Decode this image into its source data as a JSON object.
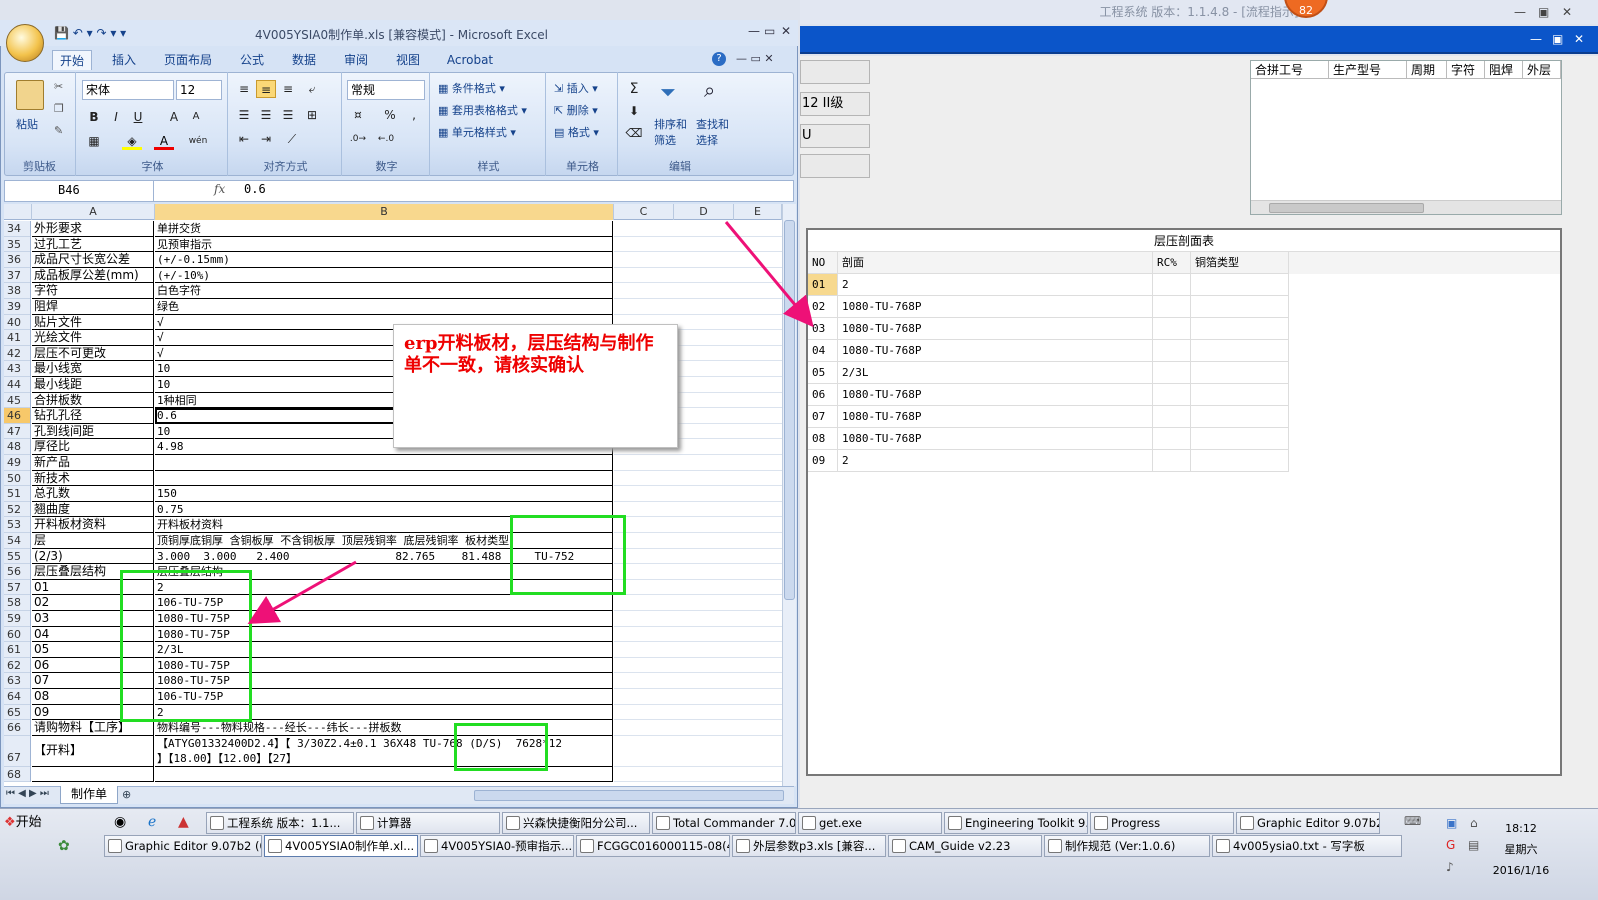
{
  "right_app": {
    "title": "工程系统  版本：1.1.4.8 - [流程指示]",
    "badge": "82",
    "left_buttons": [
      "",
      "12 II级",
      "U",
      ""
    ],
    "info_columns": [
      "合拼工号",
      "生产型号",
      "周期",
      "字符",
      "阻焊",
      "外层"
    ],
    "stack_title": "层压剖面表",
    "stack_columns": [
      "NO",
      "剖面",
      "RC%",
      "铜箔类型"
    ],
    "stack_rows": [
      [
        "01",
        "2"
      ],
      [
        "02",
        "1080-TU-768P"
      ],
      [
        "03",
        "1080-TU-768P"
      ],
      [
        "04",
        "1080-TU-768P"
      ],
      [
        "05",
        "2/3L"
      ],
      [
        "06",
        "1080-TU-768P"
      ],
      [
        "07",
        "1080-TU-768P"
      ],
      [
        "08",
        "1080-TU-768P"
      ],
      [
        "09",
        "2"
      ]
    ]
  },
  "excel": {
    "title": "4V005YSIA0制作单.xls  [兼容模式] - Microsoft Excel",
    "tabs": [
      "开始",
      "插入",
      "页面布局",
      "公式",
      "数据",
      "审阅",
      "视图",
      "Acrobat"
    ],
    "groups": [
      "剪贴板",
      "字体",
      "对齐方式",
      "数字",
      "样式",
      "单元格",
      "编辑"
    ],
    "paste": "粘贴",
    "font_name": "宋体",
    "font_size": "12",
    "number_format": "常规",
    "style_items": [
      "条件格式",
      "套用表格格式",
      "单元格样式"
    ],
    "cell_items": [
      "插入",
      "删除",
      "格式"
    ],
    "edit_items": [
      "排序和筛选",
      "查找和选择"
    ],
    "name_box": "B46",
    "formula_value": "0.6",
    "columns": [
      "A",
      "B",
      "C",
      "D",
      "E"
    ],
    "rows": [
      {
        "n": "34",
        "a": "外形要求",
        "b": "单拼交货"
      },
      {
        "n": "35",
        "a": "过孔工艺",
        "b": "见预审指示"
      },
      {
        "n": "36",
        "a": "成品尺寸长宽公差",
        "b": "(+/-0.15mm)"
      },
      {
        "n": "37",
        "a": "成品板厚公差(mm)",
        "b": "(+/-10%)"
      },
      {
        "n": "38",
        "a": "字符",
        "b": "白色字符"
      },
      {
        "n": "39",
        "a": "阻焊",
        "b": "绿色"
      },
      {
        "n": "40",
        "a": "贴片文件",
        "b": "√"
      },
      {
        "n": "41",
        "a": "光绘文件",
        "b": "√"
      },
      {
        "n": "42",
        "a": "层压不可更改",
        "b": "√"
      },
      {
        "n": "43",
        "a": "最小线宽",
        "b": "10"
      },
      {
        "n": "44",
        "a": "最小线距",
        "b": "10"
      },
      {
        "n": "45",
        "a": "合拼板数",
        "b": "1种相同"
      },
      {
        "n": "46",
        "a": "钻孔孔径",
        "b": "0.6"
      },
      {
        "n": "47",
        "a": "孔到线间距",
        "b": "10"
      },
      {
        "n": "48",
        "a": "厚径比",
        "b": "4.98"
      },
      {
        "n": "49",
        "a": "新产品",
        "b": ""
      },
      {
        "n": "50",
        "a": "新技术",
        "b": ""
      },
      {
        "n": "51",
        "a": "总孔数",
        "b": "150"
      },
      {
        "n": "52",
        "a": "翘曲度",
        "b": "0.75"
      },
      {
        "n": "53",
        "a": "开料板材资料",
        "b": "开料板材资料"
      },
      {
        "n": "54",
        "a": "层",
        "b": "顶铜厚底铜厚 含铜板厚 不含铜板厚 顶层残铜率 底层残铜率 板材类型"
      },
      {
        "n": "55",
        "a": "(2/3)",
        "b": "3.000  3.000   2.400                82.765    81.488     TU-752"
      },
      {
        "n": "56",
        "a": "层压叠层结构",
        "b": "层压叠层结构"
      },
      {
        "n": "57",
        "a": "01",
        "b": "2"
      },
      {
        "n": "58",
        "a": "02",
        "b": "106-TU-75P"
      },
      {
        "n": "59",
        "a": "03",
        "b": "1080-TU-75P"
      },
      {
        "n": "60",
        "a": "04",
        "b": "1080-TU-75P"
      },
      {
        "n": "61",
        "a": "05",
        "b": "2/3L"
      },
      {
        "n": "62",
        "a": "06",
        "b": "1080-TU-75P"
      },
      {
        "n": "63",
        "a": "07",
        "b": "1080-TU-75P"
      },
      {
        "n": "64",
        "a": "08",
        "b": "106-TU-75P"
      },
      {
        "n": "65",
        "a": "09",
        "b": "2"
      },
      {
        "n": "66",
        "a": "请购物料【工序】",
        "b": "物料编号---物料规格---经长---纬长---拼板数"
      },
      {
        "n": "67",
        "a": "【开料】",
        "b": "【ATYG01332400D2.4】【 3/30Z2.4±0.1 36X48 TU-768 (D/S)  7628*12\n】【18.00】【12.00】【27】"
      },
      {
        "n": "68",
        "a": "",
        "b": ""
      }
    ],
    "sheet_tab": "制作单"
  },
  "annotation": {
    "text": "erp开料板材，层压结构与制作单不一致，请核实确认"
  },
  "taskbar": {
    "start": "开始",
    "row1": [
      "工程系统  版本：1.1...",
      "计算器",
      "兴森快捷衡阳分公司...",
      "Total Commander 7.0 ...",
      "get.exe",
      "Engineering Toolkit 9....",
      "Progress",
      "Graphic Editor 9.07b2 ..."
    ],
    "row2": [
      "Graphic Editor 9.07b2 (0...",
      "4V005YSIA0制作单.xl...",
      "4V005YSIA0-预审指示....",
      "FCGGC016000115-08(4V...",
      "外层参数p3.xls [兼容...",
      "CAM_Guide v2.23",
      "制作规范 (Ver:1.0.6)",
      "4v005ysia0.txt - 写字板"
    ],
    "time": "18:12",
    "weekday": "星期六",
    "date": "2016/1/16"
  },
  "colors": {
    "annotation_text": "#ee0000",
    "highlight_box": "#22dd22",
    "arrow": "#ee1177"
  }
}
